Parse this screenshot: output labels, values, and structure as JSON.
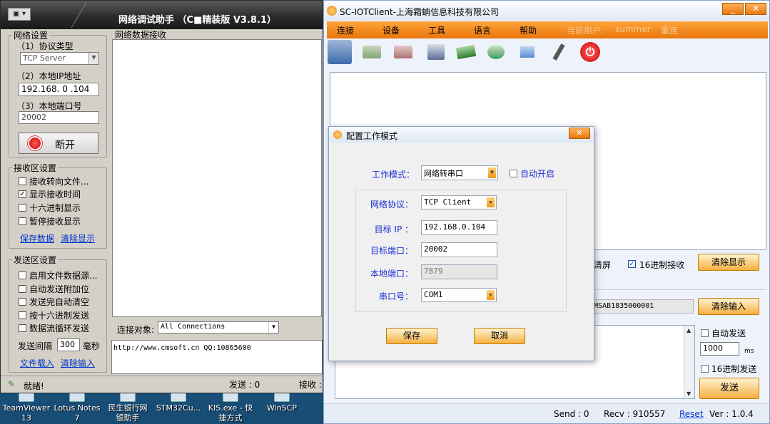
{
  "desktop": {
    "icons": [
      {
        "label": "TeamViewer\n13"
      },
      {
        "label": "Lotus Notes\n7"
      },
      {
        "label": "民生银行网\n银助手"
      },
      {
        "label": "STM32Cu..."
      },
      {
        "label": "KIS.exe - 快\n捷方式"
      },
      {
        "label": "WinSCP"
      }
    ]
  },
  "net_assistant": {
    "title": "网络调试助手 （C■精装版 V3.8.1）",
    "net_settings": {
      "legend": "网络设置",
      "protocol_label": "（1）协议类型",
      "protocol_value": "TCP Server",
      "ip_label": "（2）本地IP地址",
      "ip_value": "192.168. 0 .104",
      "port_label": "（3）本地端口号",
      "port_value": "20002",
      "disconnect_label": "断开"
    },
    "receive_settings": {
      "legend": "接收区设置",
      "options": [
        {
          "label": "接收转向文件...",
          "checked": false
        },
        {
          "label": "显示接收时间",
          "checked": true
        },
        {
          "label": "十六进制显示",
          "checked": false
        },
        {
          "label": "暂停接收显示",
          "checked": false
        }
      ],
      "save_link": "保存数据",
      "clear_link": "清除显示"
    },
    "send_settings": {
      "legend": "发送区设置",
      "options": [
        {
          "label": "启用文件数据源...",
          "checked": false
        },
        {
          "label": "自动发送附加位",
          "checked": false
        },
        {
          "label": "发送完自动清空",
          "checked": false
        },
        {
          "label": "按十六进制发送",
          "checked": false
        },
        {
          "label": "数据流循环发送",
          "checked": false
        }
      ],
      "interval_label": "发送间隔",
      "interval_value": "300",
      "interval_unit": "毫秒",
      "file_link": "文件载入",
      "clear_link": "清除输入"
    },
    "receive_area_label": "网络数据接收",
    "connect_label": "连接对象:",
    "connect_value": "All Connections",
    "send_text": "http://www.cmsoft.cn QQ:10865600",
    "status": {
      "ready": "就绪!",
      "send_label": "发送 : 0",
      "recv_label": "接收 :"
    }
  },
  "iot_client": {
    "title": "SC-IOTClient-上海霜蚺信息科技有限公司",
    "menu": [
      "连接",
      "设备",
      "工具",
      "语言",
      "帮助"
    ],
    "current_user_label": "当前用户:",
    "current_user": "summer",
    "relogin": "重连",
    "clear_screen_label": "清屏",
    "hex_receive_label": "16进制接收",
    "hex_receive_checked": true,
    "clear_display_button": "清除显示",
    "device_id": "MSAB1835000001",
    "clear_input_button": "清除输入",
    "auto_send_label": "自动发送",
    "interval_value": "1000",
    "interval_unit": "ms",
    "hex_send_label": "16进制发送",
    "send_button": "发送",
    "status": {
      "send": "Send :   0",
      "recv": "Recv :   910557",
      "reset": "Reset",
      "version": "Ver : 1.0.4"
    }
  },
  "dialog": {
    "title": "配置工作模式",
    "work_mode_label": "工作模式：",
    "work_mode_value": "网络转串口",
    "auto_start_label": "自动开启",
    "protocol_label": "网络协议：",
    "protocol_value": "TCP Client",
    "target_ip_label": "目标 IP ：",
    "target_ip_value": "192.168.0.104",
    "target_port_label": "目标端口：",
    "target_port_value": "20002",
    "local_port_label": "本地端口：",
    "local_port_value": "7879",
    "serial_label": "串口号：",
    "serial_value": "COM1",
    "save_button": "保存",
    "cancel_button": "取消"
  },
  "colors": {
    "accent_orange": "#f08a1c",
    "link_blue": "#0033cc",
    "label_blue": "#1a2fd6"
  }
}
